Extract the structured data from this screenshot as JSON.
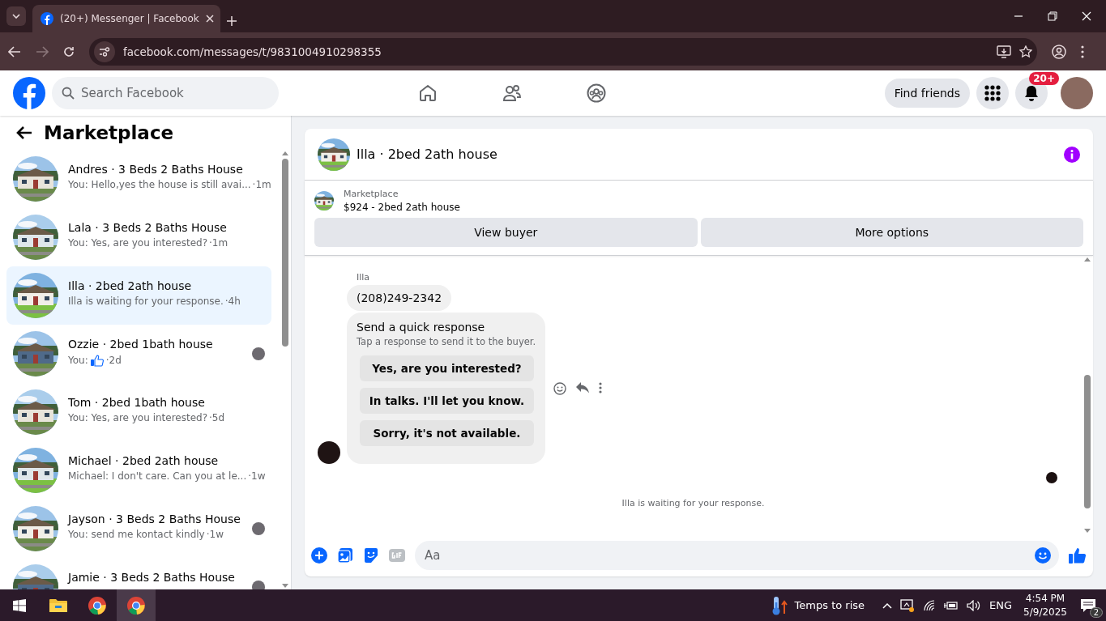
{
  "browser": {
    "tab": {
      "title": "(20+) Messenger | Facebook",
      "selected": true
    },
    "url": "facebook.com/messages/t/9831004910298355"
  },
  "header": {
    "search": {
      "placeholder": "Search Facebook"
    },
    "find_friends": "Find friends",
    "notifications_badge": "20+"
  },
  "sidebar": {
    "title": "Marketplace",
    "conversations": [
      {
        "title": "Andres · 3 Beds 2 Baths House",
        "preview": "You: Hello,yes the house is still avai...",
        "time": "·1m",
        "like": false,
        "seen_avatar": false,
        "selected": false
      },
      {
        "title": "Lala · 3 Beds 2 Baths House",
        "preview": "You: Yes, are you interested?",
        "time": "·1m",
        "like": false,
        "seen_avatar": false,
        "selected": false
      },
      {
        "title": "Illa · 2bed 2ath house",
        "preview": "Illa is waiting for your response.",
        "time": "·4h",
        "like": false,
        "seen_avatar": false,
        "selected": true
      },
      {
        "title": "Ozzie · 2bed 1bath house",
        "preview": "You:",
        "time": "·2d",
        "like": true,
        "seen_avatar": true,
        "selected": false
      },
      {
        "title": "Tom · 2bed 1bath house",
        "preview": "You: Yes, are you interested?",
        "time": "·5d",
        "like": false,
        "seen_avatar": false,
        "selected": false
      },
      {
        "title": "Michael · 2bed 2ath house",
        "preview": "Michael: I don't care. Can you at le...",
        "time": "·1w",
        "like": false,
        "seen_avatar": false,
        "selected": false
      },
      {
        "title": "Jayson · 3 Beds 2 Baths House",
        "preview": "You: send me kontact kindly",
        "time": "·1w",
        "like": false,
        "seen_avatar": true,
        "selected": false
      },
      {
        "title": "Jamie · 3 Beds 2 Baths House",
        "like": false,
        "seen_avatar": true,
        "selected": false
      }
    ]
  },
  "chat": {
    "title": "Illa · 2bed 2ath house",
    "listing": {
      "label": "Marketplace",
      "name": "$924 - 2bed 2ath house"
    },
    "actions": [
      "View buyer",
      "More options"
    ],
    "sender": "Illa",
    "message": "(208)249-2342",
    "quick_response": {
      "title": "Send a quick response",
      "subtitle": "Tap a response to send it to the buyer.",
      "options": [
        "Yes, are you interested?",
        "In talks. I'll let you know.",
        "Sorry, it's not available."
      ]
    },
    "status": "Illa is waiting for your response.",
    "composer": {
      "placeholder": "Aa"
    }
  },
  "taskbar": {
    "weather": "Temps to rise",
    "language": "ENG",
    "time": "4:54 PM",
    "date": "5/9/2025",
    "notifications": "2"
  }
}
